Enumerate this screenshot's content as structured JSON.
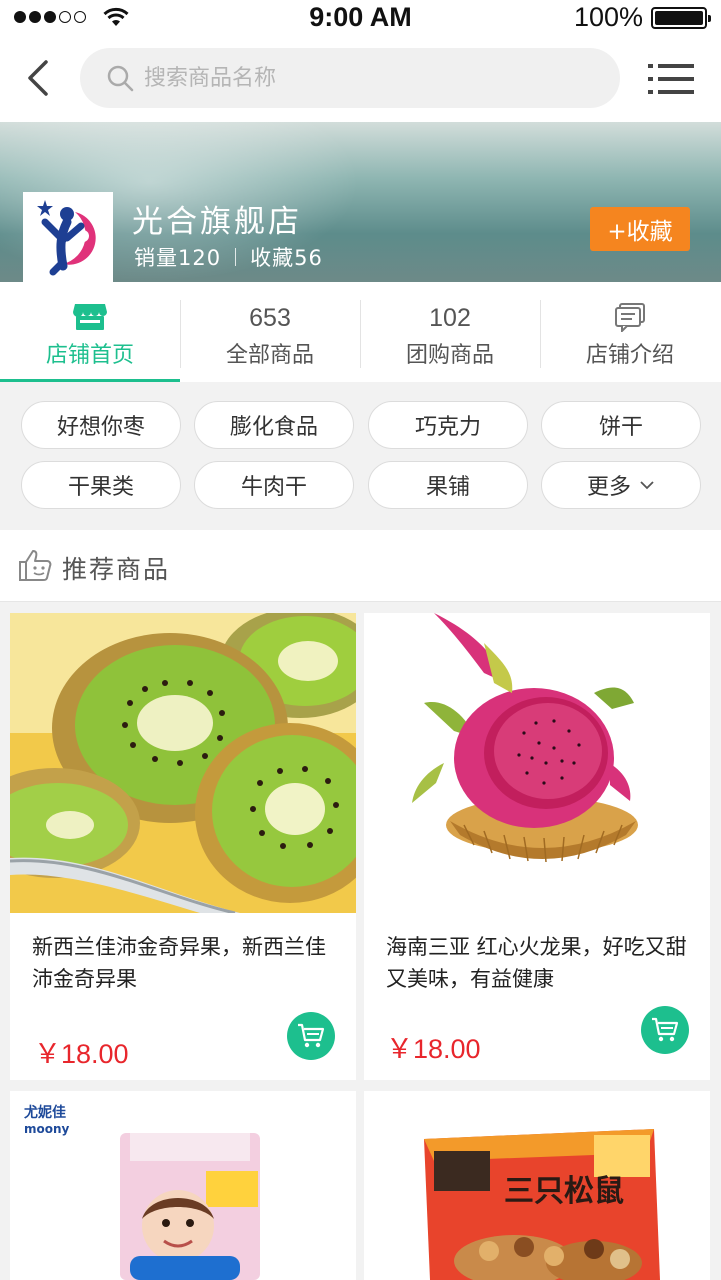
{
  "status_bar": {
    "time": "9:00 AM",
    "battery": "100%"
  },
  "search": {
    "placeholder": "搜索商品名称"
  },
  "store": {
    "name": "光合旗舰店",
    "sales": "销量120",
    "favorites": "收藏56",
    "fav_button": "+收藏"
  },
  "tabs": [
    {
      "label": "店铺首页",
      "count": ""
    },
    {
      "label": "全部商品",
      "count": "653"
    },
    {
      "label": "团购商品",
      "count": "102"
    },
    {
      "label": "店铺介绍",
      "count": ""
    }
  ],
  "categories": [
    "好想你枣",
    "膨化食品",
    "巧克力",
    "饼干",
    "干果类",
    "牛肉干",
    "果铺",
    "更多"
  ],
  "recommend": {
    "title": "推荐商品"
  },
  "products": [
    {
      "title": "新西兰佳沛金奇异果，新西兰佳沛金奇异果",
      "price": "￥18.00"
    },
    {
      "title": "海南三亚 红心火龙果，好吃又甜又美味，有益健康",
      "price": "￥18.00"
    },
    {
      "brand_cn": "尤妮佳",
      "brand_en": "moony"
    },
    {
      "brand_cn": "三只松鼠"
    }
  ],
  "colors": {
    "accent": "#1dbf8e",
    "favorite": "#f5851f",
    "price": "#e8262c"
  }
}
